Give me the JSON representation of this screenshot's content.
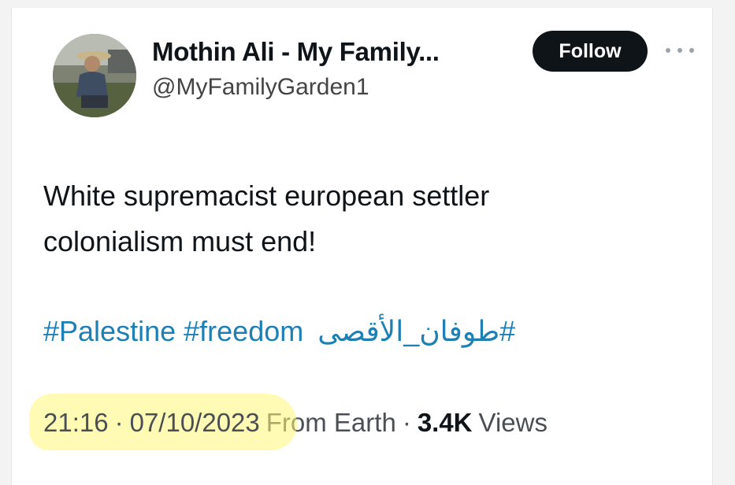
{
  "author": {
    "display_name": "Mothin Ali - My Family...",
    "handle": "@MyFamilyGarden1"
  },
  "follow_button": {
    "label": "Follow"
  },
  "more_icon": "more-horizontal-icon",
  "tweet": {
    "text_line1": "White supremacist european settler",
    "text_line2": "colonialism must end!",
    "hashtags": [
      "#Palestine",
      "#freedom",
      "#طوفان_الأقصى"
    ]
  },
  "meta": {
    "time": "21:16",
    "dot1": "·",
    "date": "07/10/2023",
    "source": "From Earth",
    "dot2": "·",
    "views_count": "3.4K",
    "views_label": "Views"
  },
  "colors": {
    "hashtag": "#1d7fb4",
    "highlight": "#fff778",
    "follow_bg": "#0f1419"
  }
}
